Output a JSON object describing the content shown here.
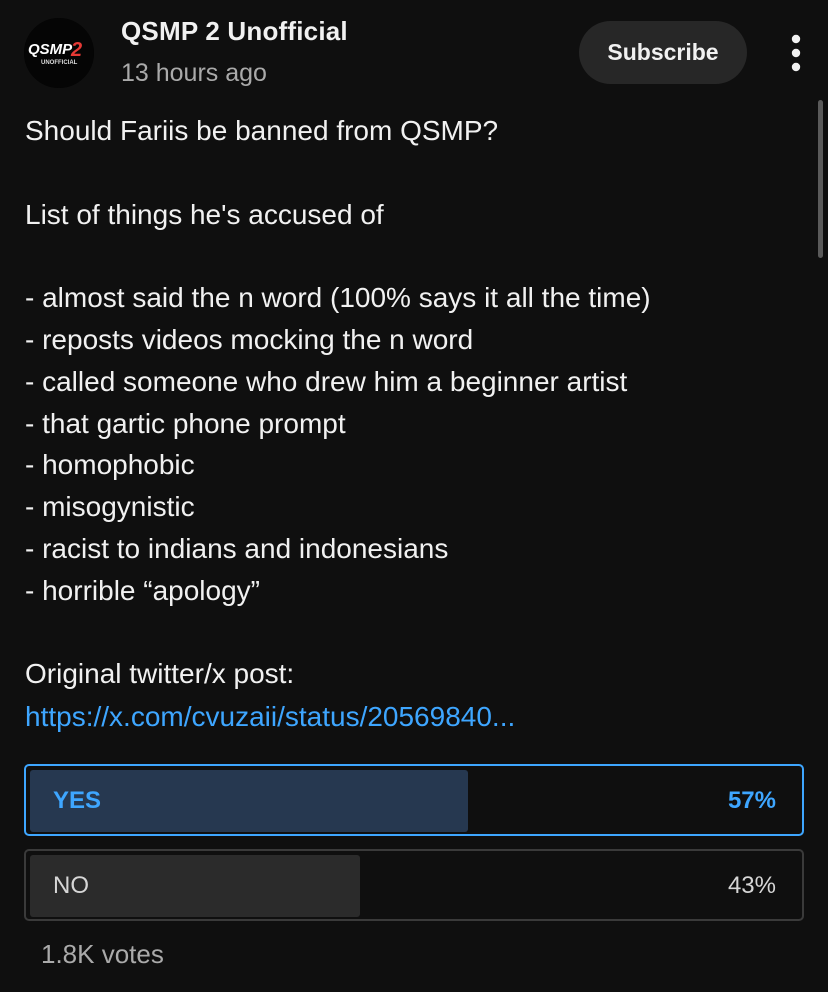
{
  "channel": {
    "name": "QSMP 2 Unofficial",
    "time": "13 hours ago",
    "avatar_text": "QSMP 2",
    "avatar_subtext": "UNOFFICIAL",
    "avatar_icon": "channel-logo",
    "subscribe_label": "Subscribe",
    "more_icon": "more-vertical-icon"
  },
  "post": {
    "lines": [
      "Should Fariis be banned from QSMP?",
      "",
      "List of things he's accused of",
      "",
      "- almost said the n word (100% says it all the time)",
      "- reposts videos mocking the n word",
      "- called someone who drew him a beginner artist",
      "- that gartic phone prompt",
      "- homophobic",
      "- misogynistic",
      "- racist to indians and indonesians",
      "- horrible “apology”",
      "",
      "Original twitter/x post:"
    ],
    "link": "https://x.com/cvuzaii/status/20569840..."
  },
  "poll": {
    "options": [
      {
        "label": "YES",
        "percent_text": "57%",
        "percent": 57,
        "selected": true
      },
      {
        "label": "NO",
        "percent_text": "43%",
        "percent": 43,
        "selected": false
      }
    ],
    "votes": "1.8K votes"
  },
  "colors": {
    "background": "#0f0f0f",
    "accent": "#3ea6ff",
    "selected_fill": "#263850",
    "unselected_fill": "#2b2b2b",
    "button_bg": "#272727",
    "secondary_text": "#aaaaaa"
  }
}
